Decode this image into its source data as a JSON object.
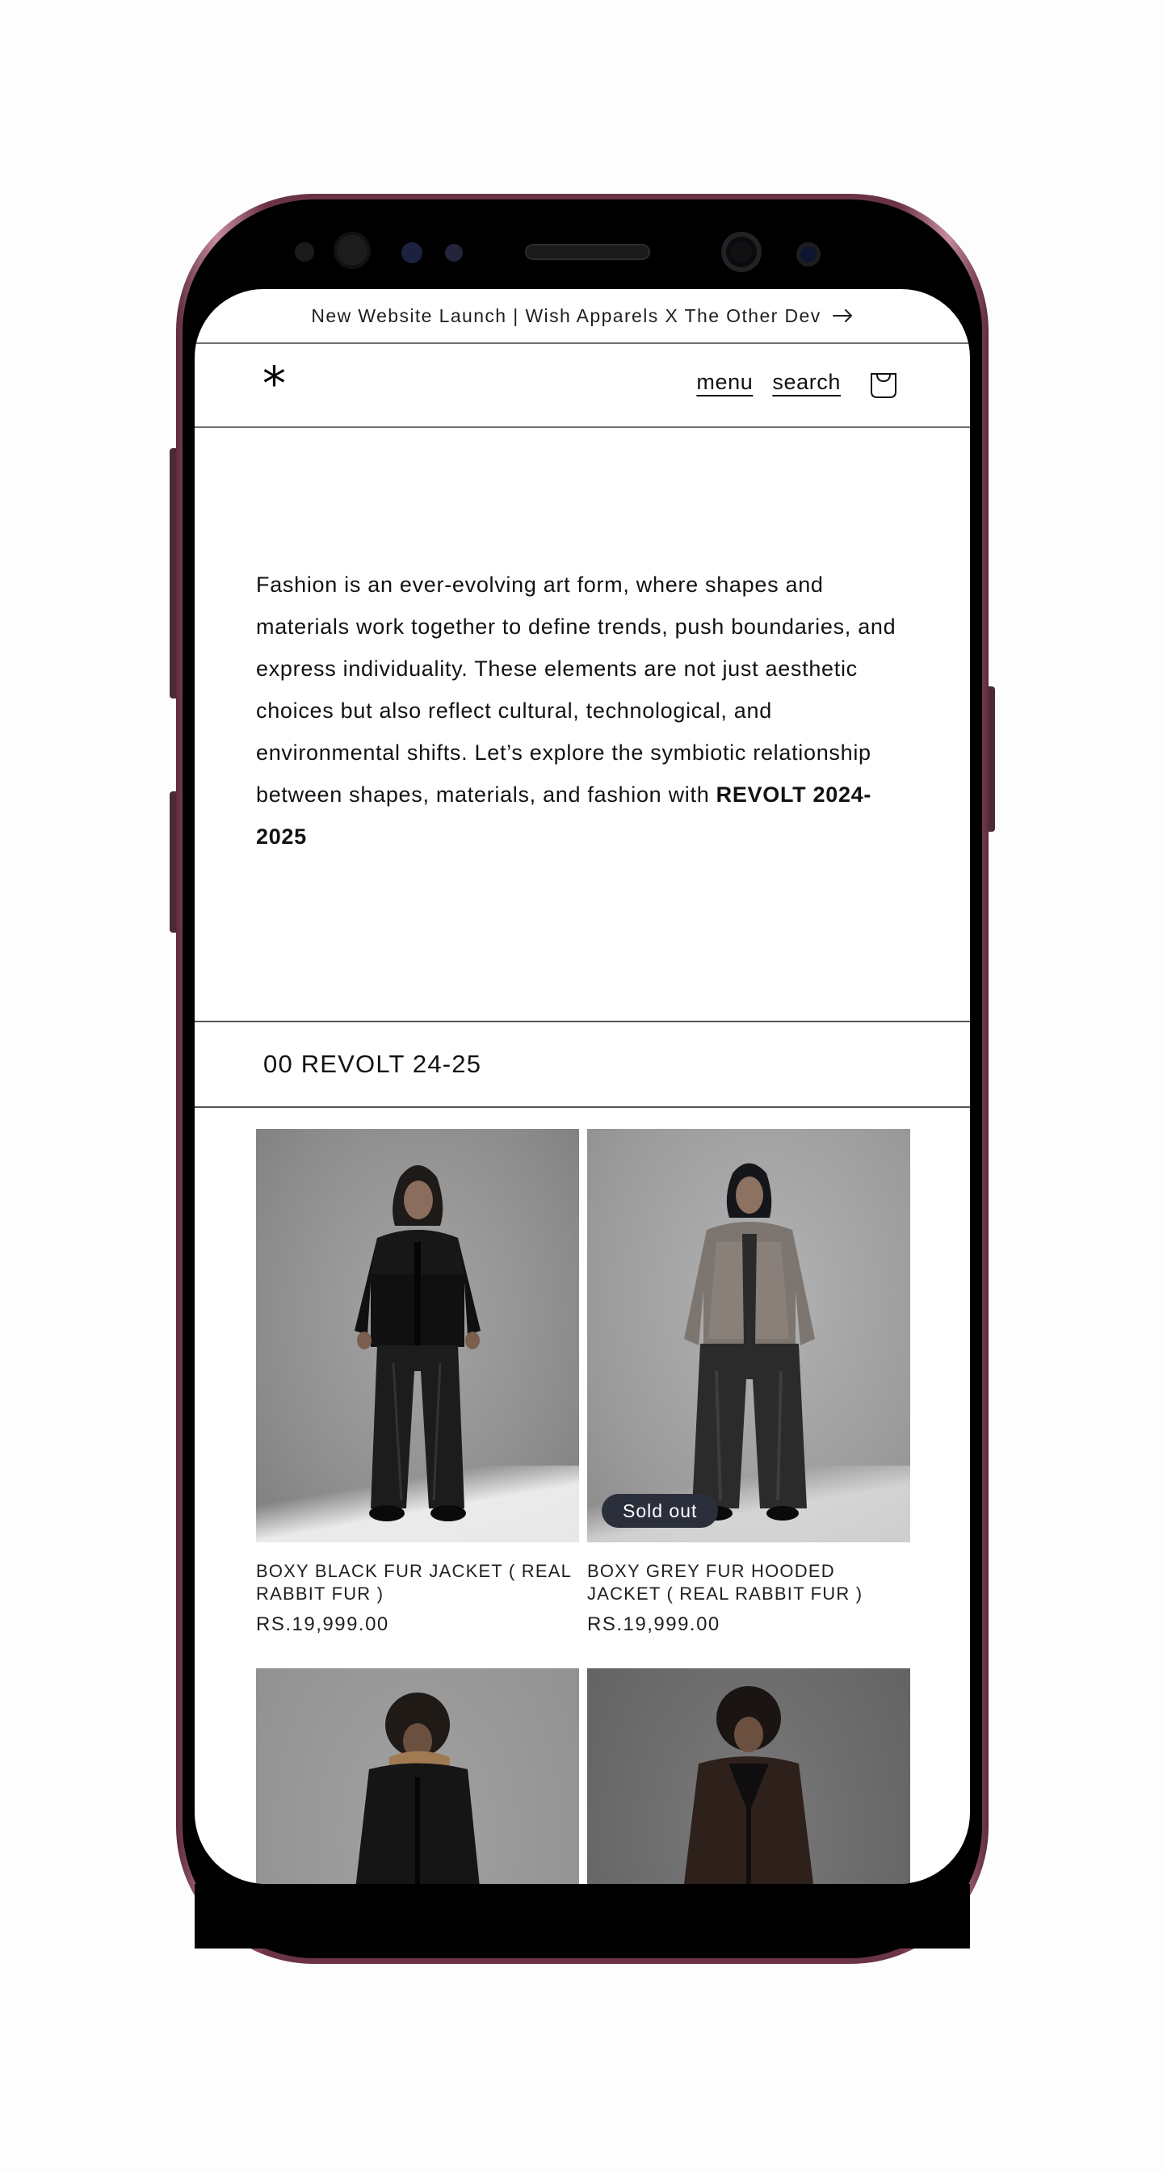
{
  "announcement": {
    "text": "New Website Launch | Wish Apparels X The Other Dev",
    "icon": "arrow-right-icon"
  },
  "header": {
    "logo": "*",
    "nav": [
      {
        "label": "menu"
      },
      {
        "label": "search"
      }
    ],
    "cart_icon": "shopping-bag-icon"
  },
  "intro": {
    "text": "Fashion is an ever-evolving art form, where shapes and materials work together to define trends, push boundaries, and express individuality. These elements are not just aesthetic choices but also reflect cultural, technological, and environmental shifts. Let’s explore the symbiotic relationship between shapes, materials, and fashion with ",
    "highlight": "REVOLT 2024-2025"
  },
  "collection": {
    "title": "00 REVOLT 24-25",
    "products": [
      {
        "title": "BOXY BLACK FUR JACKET ( REAL RABBIT FUR )",
        "price": "RS.19,999.00",
        "badge": ""
      },
      {
        "title": "BOXY GREY FUR HOODED JACKET ( REAL RABBIT FUR )",
        "price": "RS.19,999.00",
        "badge": "Sold out"
      },
      {
        "title": "",
        "price": "",
        "badge": ""
      },
      {
        "title": "",
        "price": "",
        "badge": ""
      }
    ]
  },
  "colors": {
    "frame": "#6b3346",
    "badge": "#2b2f3b",
    "text": "#121212"
  }
}
